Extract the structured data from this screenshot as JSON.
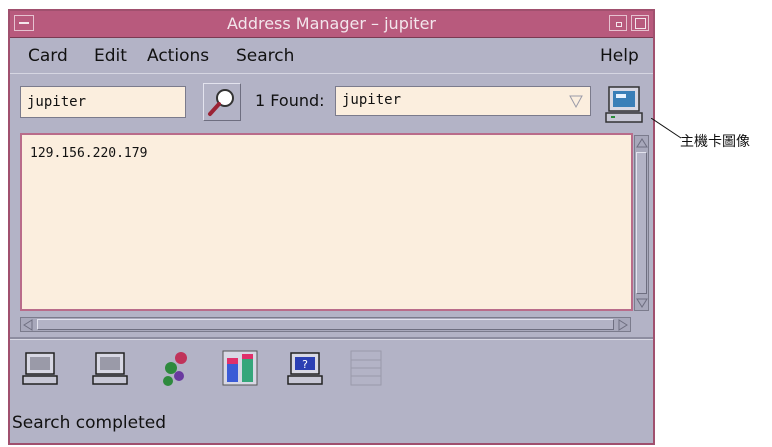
{
  "window": {
    "title": "Address Manager – jupiter"
  },
  "menubar": {
    "items": [
      "Card",
      "Edit",
      "Actions",
      "Search"
    ],
    "help": "Help"
  },
  "toolbar": {
    "search_value": "jupiter",
    "found_label": "1 Found:",
    "found_value": "jupiter"
  },
  "content": {
    "text": "129.156.220.179"
  },
  "iconbar": {
    "icons": [
      "host-card-icon",
      "host-card-icon",
      "gear-cluster-icon",
      "bar-chart-icon",
      "help-host-icon",
      "list-icon"
    ]
  },
  "status": {
    "text": "Search completed"
  },
  "callout": {
    "text": "主機卡圖像"
  },
  "colors": {
    "titlebar": "#b85a7d",
    "window_bg": "#b3b3c6",
    "field_bg": "#fbeede"
  }
}
